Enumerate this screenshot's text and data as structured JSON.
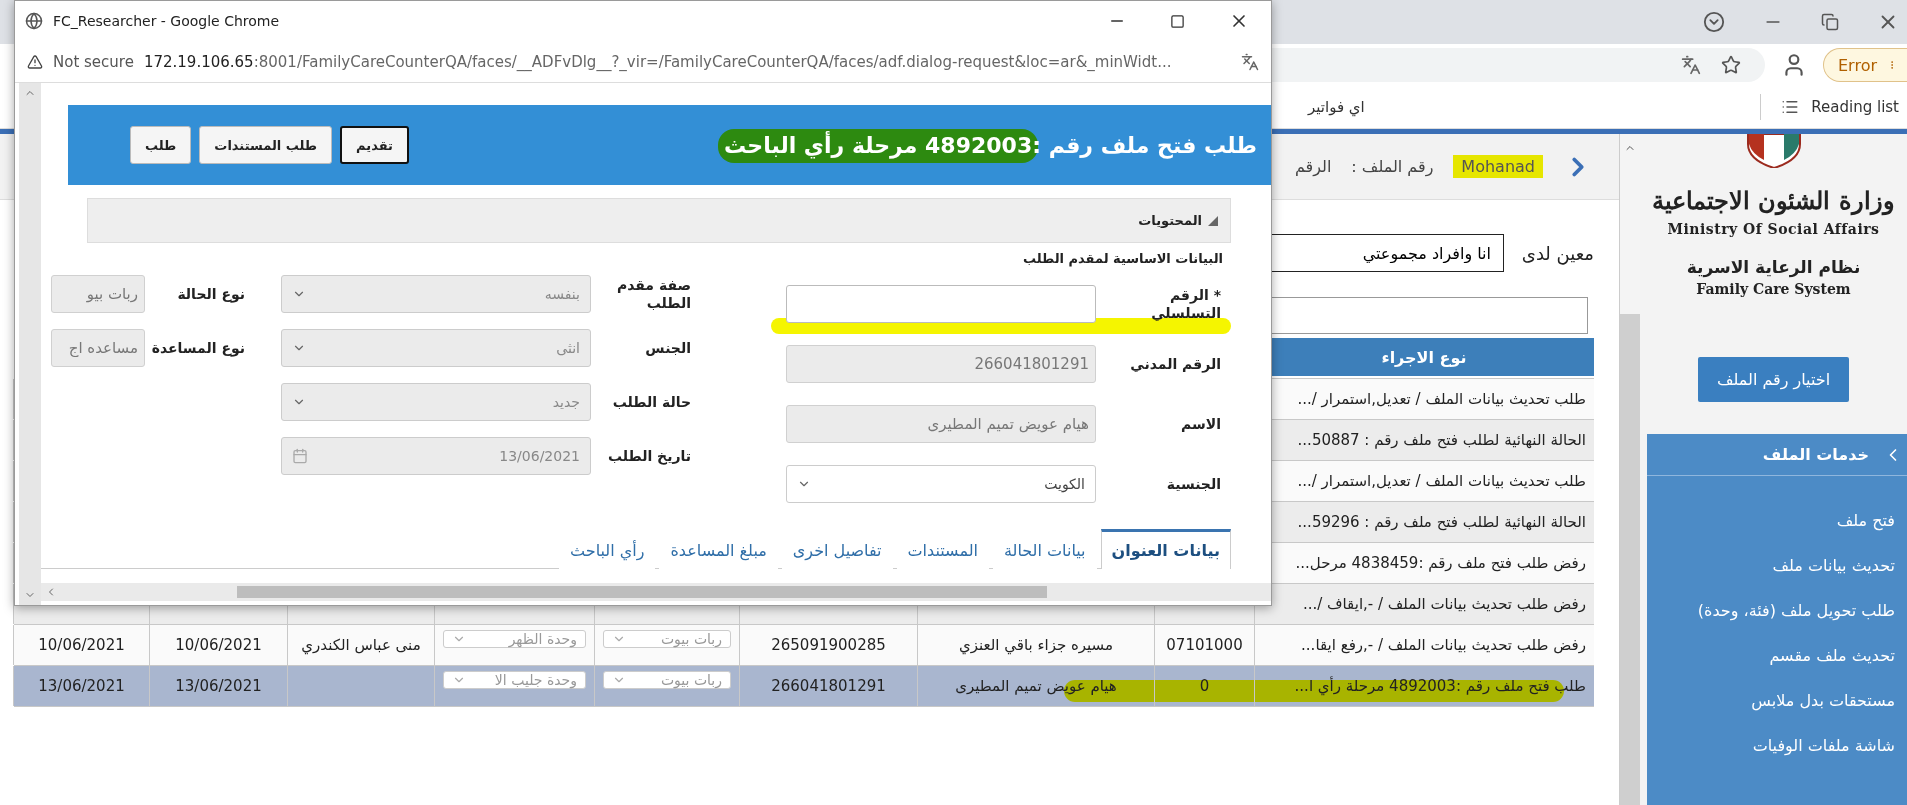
{
  "browser": {
    "bookmark": "اي فواتير",
    "reading_list": "Reading list",
    "profile_button": "Error"
  },
  "app_header": {
    "number_label": "الرقم",
    "file_label": "رقم الملف :",
    "user": "Mohanad",
    "user_highlighted": true
  },
  "assigned": {
    "label": "معين لدى",
    "value": "انا وافراد مجموعتي"
  },
  "table": {
    "columns": [
      "نوع الاجراء"
    ],
    "rows": [
      {
        "selected": false,
        "highlighted": false,
        "cells": [
          {
            "kind": "text",
            "text": "طلب تحديث بيانات الملف / تعديل,استمرار /..."
          }
        ]
      },
      {
        "selected": false,
        "highlighted": false,
        "cells": [
          {
            "kind": "text",
            "text": "الحالة النهائية لطلب فتح ملف رقم : 50887..."
          }
        ]
      },
      {
        "selected": false,
        "highlighted": false,
        "cells": [
          {
            "kind": "text",
            "text": "طلب تحديث بيانات الملف / تعديل,استمرار /..."
          }
        ]
      },
      {
        "selected": false,
        "highlighted": false,
        "cells": [
          {
            "kind": "text",
            "text": "الحالة النهائية لطلب فتح ملف رقم : 59296..."
          }
        ]
      },
      {
        "selected": false,
        "highlighted": false,
        "cells": [
          {
            "kind": "text",
            "text": "رفض طلب فتح ملف رقم :4838459 مرحل..."
          }
        ]
      },
      {
        "selected": false,
        "highlighted": false,
        "cells": [
          {
            "kind": "text",
            "text": "رفض طلب تحديث بيانات الملف / -,ايقاف /..."
          }
        ]
      },
      {
        "selected": false,
        "highlighted": false,
        "cells": [
          {
            "kind": "text",
            "text": "رفض طلب تحديث بيانات الملف / -,رفع ايقا..."
          },
          {
            "kind": "text",
            "text": "07101000"
          },
          {
            "kind": "text",
            "text": "مسيره جزاء باقي العنزي"
          },
          {
            "kind": "text",
            "text": "265091900285"
          },
          {
            "kind": "select",
            "text": "ربات بيوت"
          },
          {
            "kind": "select",
            "text": "وحدة الظهر"
          },
          {
            "kind": "text",
            "text": "منى عباس الكندري"
          },
          {
            "kind": "text",
            "text": "10/06/2021"
          },
          {
            "kind": "text",
            "text": "10/06/2021"
          }
        ]
      },
      {
        "selected": true,
        "highlighted": true,
        "cells": [
          {
            "kind": "text",
            "text": "طلب فتح ملف رقم :4892003 مرحلة رأي ا..."
          },
          {
            "kind": "text",
            "text": "0"
          },
          {
            "kind": "text",
            "text": "هيام عويض تميم المطيرى"
          },
          {
            "kind": "text",
            "text": "266041801291"
          },
          {
            "kind": "select",
            "text": "ربات بيوت"
          },
          {
            "kind": "select",
            "text": "وحدة جليب الا"
          },
          {
            "kind": "empty"
          },
          {
            "kind": "text",
            "text": "13/06/2021"
          },
          {
            "kind": "text",
            "text": "13/06/2021"
          }
        ]
      }
    ]
  },
  "sidebar": {
    "logo_arabic": "وزارة الشئون الاجتماعية",
    "logo_english": "Ministry Of Social Affairs",
    "system_arabic": "نظام الرعاية الاسرية",
    "system_english": "Family Care System",
    "select_button": "اختيار رقم الملف",
    "menu": {
      "title": "خدمات الملف",
      "expanded": true,
      "items": [
        "فتح ملف",
        "تحديث بيانات ملف",
        "طلب تحويل ملف (فئة، وحدة)",
        "تحديث ملف مقسم",
        "مستحقات بدل ملابس",
        "شاشة ملفات الوفيات"
      ]
    }
  },
  "popup": {
    "window_title": "FC_Researcher - Google Chrome",
    "security": "Not secure",
    "url_host": "172.19.106.65",
    "url_rest": ":8001/FamilyCareCounterQA/faces/__ADFvDlg__?_vir=/FamilyCareCounterQA/faces/adf.dialog-request&loc=ar&_minWidt...",
    "header": {
      "title": "طلب فتح ملف رقم :4892003 مرحلة رأي الباحث",
      "highlighted": true,
      "buttons": [
        {
          "label": "تقديم",
          "focused": true
        },
        {
          "label": "طلب المستندات",
          "focused": false
        },
        {
          "label": "طلب",
          "focused": false
        }
      ]
    },
    "section": "المحتويات",
    "subtitle": "البيانات الاساسية لمقدم الطلب",
    "columns": [
      [
        {
          "label": "* الرقم التسلسلي",
          "kind": "input",
          "disabled": false,
          "highlighted": true
        },
        {
          "label": "الرقم المدني",
          "kind": "input",
          "value": "266041801291",
          "disabled": true
        },
        {
          "label": "الاسم",
          "kind": "input",
          "value": "هيام عويض تميم المطيرى",
          "disabled": true
        },
        {
          "label": "الجنسية",
          "kind": "select",
          "value": "الكويت",
          "disabled": false
        }
      ],
      [
        {
          "label": "صفة مقدم الطلب",
          "kind": "select",
          "value": "بنفسه",
          "disabled": true
        },
        {
          "label": "الجنس",
          "kind": "select",
          "value": "انثى",
          "disabled": true
        },
        {
          "label": "حالة الطلب",
          "kind": "select",
          "value": "جديد",
          "disabled": true
        },
        {
          "label": "تاريخ الطلب",
          "kind": "date",
          "value": "13/06/2021",
          "disabled": true
        }
      ],
      [
        {
          "label": "نوع الحالة",
          "kind": "input",
          "value": "ربات بيو",
          "disabled": true
        },
        {
          "label": "نوع المساعدة",
          "kind": "input",
          "value": "مساعده اج",
          "disabled": true
        }
      ]
    ],
    "tabs": [
      {
        "label": "بيانات العنوان",
        "selected": true
      },
      {
        "label": "بيانات الحالة",
        "selected": false
      },
      {
        "label": "المستندات",
        "selected": false
      },
      {
        "label": "تفاصيل اخرى",
        "selected": false
      },
      {
        "label": "مبلغ المساعدة",
        "selected": false
      },
      {
        "label": "رأي الباحث",
        "selected": false
      }
    ]
  }
}
